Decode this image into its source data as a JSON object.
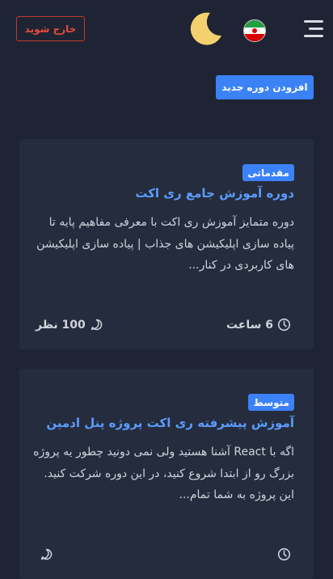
{
  "header": {
    "logout_label": "خارج شوید",
    "theme_icon": "moon-icon",
    "flag_icon": "iran-flag-icon",
    "menu_icon": "hamburger-icon"
  },
  "actions": {
    "add_course_label": "افزودن دوره جدید"
  },
  "courses": [
    {
      "level": "مقدماتی",
      "title": "دوره آموزش جامع ری اکت",
      "description": "دوره متمایز آموزش ری اکت با معرفی مفاهیم پایه تا پیاده سازی اپلیکیشن های جذاب | پیاده سازی اپلیکیشن های کاربردی در کنار...",
      "duration": "6 ساعت",
      "views": "100 نظر"
    },
    {
      "level": "متوسط",
      "title": "آموزش پیشرفته ری اکت پروژه پنل ادمین",
      "description": "اگه با React آشنا هستید ولی نمی دونید چطور یه پروژه بزرگ رو از ابتدا شروع کنید، در این دوره شرکت کنید. این پروژه به شما تمام...",
      "duration": "",
      "views": ""
    }
  ],
  "colors": {
    "background": "#1e2433",
    "card": "#252c3d",
    "accent": "#3b82f6",
    "link": "#5a9cff",
    "danger": "#e74c3c",
    "moon": "#f5d06f"
  }
}
